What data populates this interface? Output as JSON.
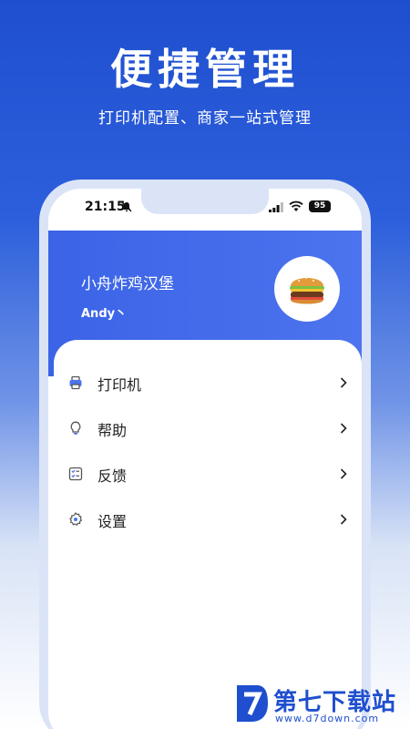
{
  "promo": {
    "headline": "便捷管理",
    "subline": "打印机配置、商家一站式管理"
  },
  "status_bar": {
    "time": "21:15",
    "battery": "95"
  },
  "profile": {
    "shop_name": "小舟炸鸡汉堡",
    "user_name": "Andy丶",
    "avatar_icon": "burger-icon"
  },
  "menu": {
    "items": [
      {
        "label": "打印机",
        "icon": "printer-icon"
      },
      {
        "label": "帮助",
        "icon": "lightbulb-icon"
      },
      {
        "label": "反馈",
        "icon": "feedback-icon"
      },
      {
        "label": "设置",
        "icon": "gear-icon"
      }
    ]
  },
  "watermark": {
    "title": "第七下载站",
    "url": "www.d7down.com"
  },
  "colors": {
    "brand_blue": "#1f4fcf",
    "header_blue": "#4c74ee"
  }
}
